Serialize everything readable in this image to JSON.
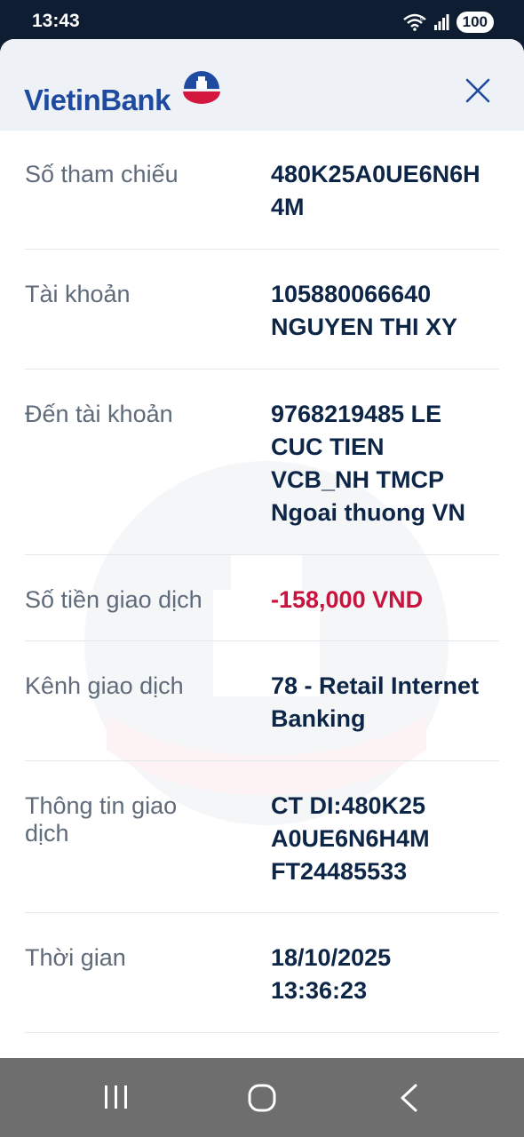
{
  "status_bar": {
    "time": "13:43",
    "battery": "100",
    "icons": [
      "wifi-6-icon",
      "signal-icon",
      "battery-icon"
    ]
  },
  "header": {
    "brand_name": "VietinBank",
    "icons": [
      "vietinbank-logo-icon",
      "close-icon"
    ]
  },
  "colors": {
    "brand_blue": "#1e4aa0",
    "brand_red": "#d4173f",
    "amount_red": "#c8133e",
    "value_navy": "#0d2647",
    "label_gray": "#5f6b7a"
  },
  "details": [
    {
      "label": "Số tham chiếu",
      "value": "480K25A0UE6N6H\n4M"
    },
    {
      "label": "Tài khoản",
      "value": "105880066640\nNGUYEN THI XY"
    },
    {
      "label": "Đến tài khoản",
      "value": "9768219485 LE\nCUC TIEN\nVCB_NH TMCP\nNgoai thuong VN"
    },
    {
      "label": "Số tiền giao dịch",
      "value": "-158,000 VND"
    },
    {
      "label": "Kênh giao dịch",
      "value": "78 - Retail Internet\nBanking"
    },
    {
      "label": "Thông tin giao dịch",
      "value": "CT DI:480K25\nA0UE6N6H4M\nFT24485533"
    },
    {
      "label": "Thời gian",
      "value": "18/10/2025\n13:36:23"
    }
  ],
  "nav_bar": {
    "icons": [
      "recent-apps-icon",
      "home-icon",
      "back-icon"
    ]
  }
}
